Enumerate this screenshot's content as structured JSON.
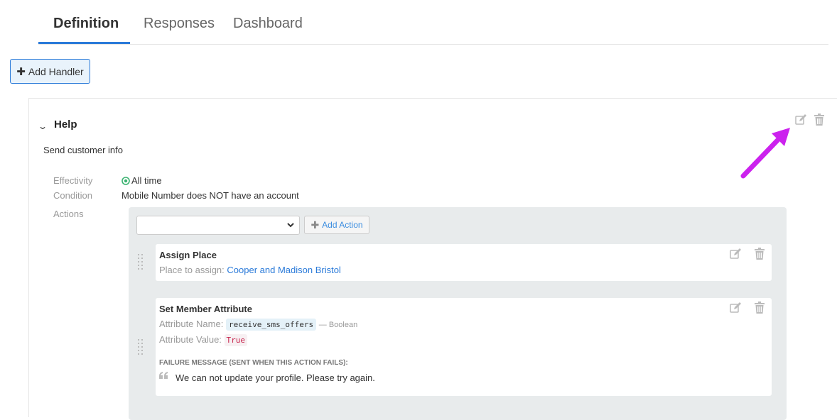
{
  "tabs": [
    {
      "label": "Definition",
      "active": true
    },
    {
      "label": "Responses",
      "active": false
    },
    {
      "label": "Dashboard",
      "active": false
    }
  ],
  "toolbar": {
    "add_handler_label": "Add Handler"
  },
  "handler": {
    "title": "Help",
    "description": "Send customer info",
    "fields": {
      "effectivity_label": "Effectivity",
      "effectivity_value": "All time",
      "condition_label": "Condition",
      "condition_value": "Mobile Number does NOT have an account",
      "actions_label": "Actions"
    },
    "actions_panel": {
      "select_value": "",
      "add_action_label": "Add Action",
      "actions": [
        {
          "title": "Assign Place",
          "place_label": "Place to assign:",
          "place_value": "Cooper and Madison Bristol"
        },
        {
          "title": "Set Member Attribute",
          "attr_name_label": "Attribute Name:",
          "attr_name_value": "receive_sms_offers",
          "attr_type": "— Boolean",
          "attr_value_label": "Attribute Value:",
          "attr_value_value": "True",
          "failure_label": "FAILURE MESSAGE (SENT WHEN THIS ACTION FAILS):",
          "failure_message": "We can not update your profile. Please try again."
        }
      ]
    }
  },
  "colors": {
    "accent": "#2a7ad9",
    "success": "#3cb371",
    "annotation_arrow": "#cc22ee"
  },
  "icons": [
    "plus-icon",
    "chevron-down-icon",
    "edit-icon",
    "trash-icon",
    "check-circle-icon",
    "drag-handle-icon",
    "quote-icon",
    "arrow-annotation"
  ]
}
